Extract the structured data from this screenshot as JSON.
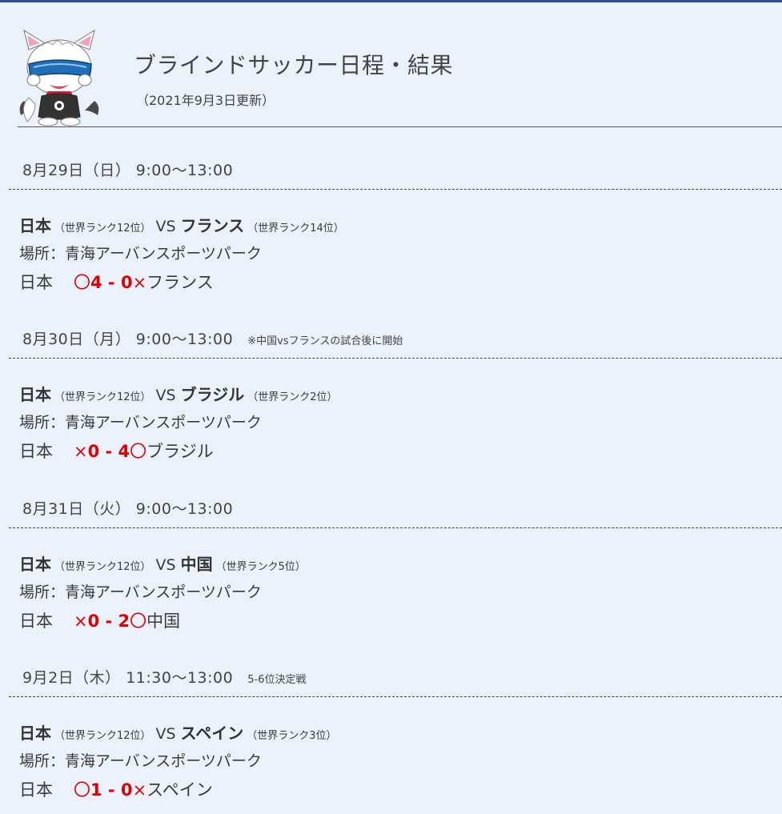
{
  "header": {
    "title": "ブラインドサッカー日程・結果",
    "updated": "（2021年9月3日更新）"
  },
  "matches": [
    {
      "date": "8月29日（日） 9:00～13:00",
      "note": "",
      "home": "日本",
      "home_rank": "（世界ランク12位）",
      "vs": "VS",
      "away": "フランス",
      "away_rank": "（世界ランク14位）",
      "venue": "場所：青海アーバンスポーツパーク",
      "result_home": "日本",
      "home_mark": "〇",
      "score": "4 - 0",
      "away_mark": "×",
      "result_away": "フランス"
    },
    {
      "date": "8月30日（月） 9:00～13:00",
      "note": "※中国vsフランスの試合後に開始",
      "home": "日本",
      "home_rank": "（世界ランク12位）",
      "vs": "VS",
      "away": "ブラジル",
      "away_rank": "（世界ランク2位）",
      "venue": "場所：青海アーバンスポーツパーク",
      "result_home": "日本",
      "home_mark": "×",
      "score": "0 - 4",
      "away_mark": "〇",
      "result_away": "ブラジル"
    },
    {
      "date": "8月31日（火） 9:00～13:00",
      "note": "",
      "home": "日本",
      "home_rank": "（世界ランク12位）",
      "vs": "VS",
      "away": "中国",
      "away_rank": "（世界ランク5位）",
      "venue": "場所：青海アーバンスポーツパーク",
      "result_home": "日本",
      "home_mark": "×",
      "score": "0 - 2",
      "away_mark": "〇",
      "result_away": "中国"
    },
    {
      "date": "9月2日（木） 11:30～13:00",
      "note": "5-6位決定戦",
      "home": "日本",
      "home_rank": "（世界ランク12位）",
      "vs": "VS",
      "away": "スペイン",
      "away_rank": "（世界ランク3位）",
      "venue": "場所：青海アーバンスポーツパーク",
      "result_home": "日本",
      "home_mark": "〇",
      "score": "1 - 0",
      "away_mark": "×",
      "result_away": "スペイン"
    }
  ],
  "colors": {
    "background": "#ebf2fc",
    "top_bar": "#2b4f8f",
    "score": "#e00000",
    "text": "#3a3a3a"
  },
  "icons": {
    "mascot": "mascot-cat-with-visor-icon"
  }
}
